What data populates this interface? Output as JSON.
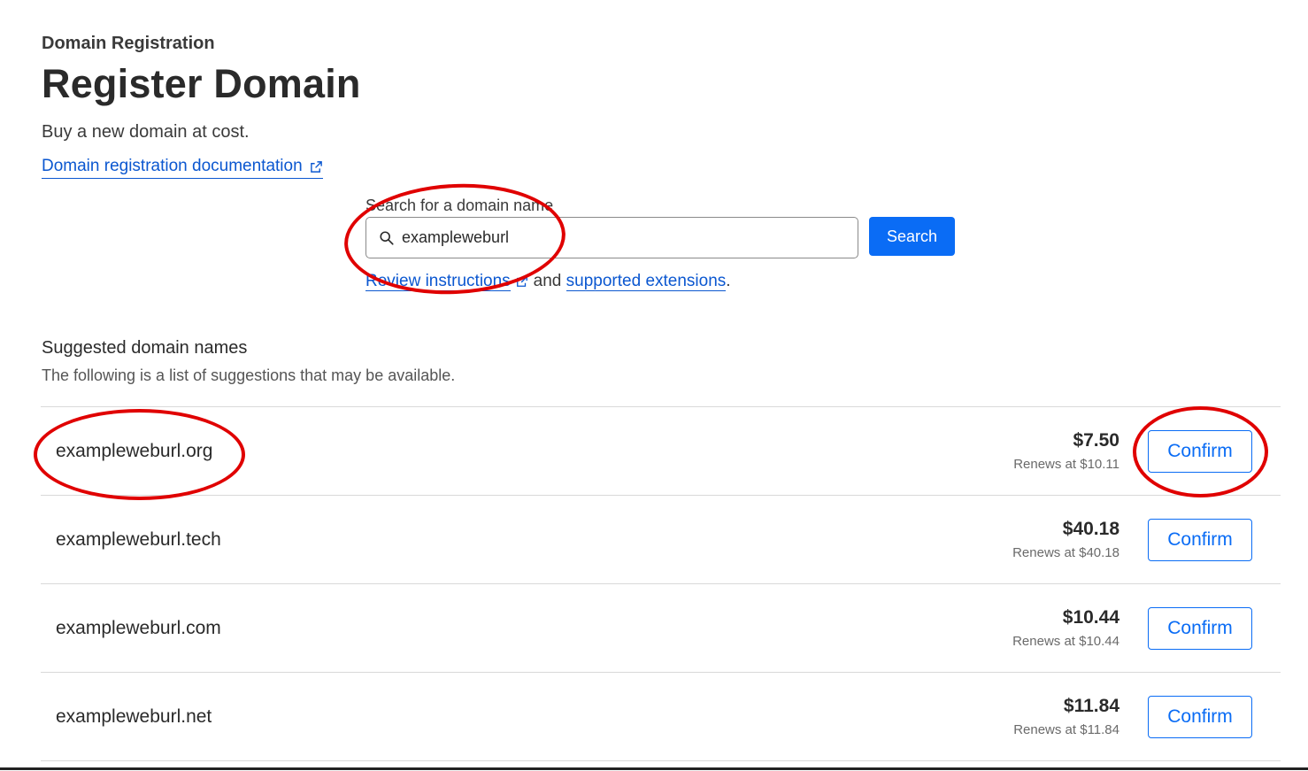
{
  "header": {
    "eyebrow": "Domain Registration",
    "title": "Register Domain",
    "subtitle": "Buy a new domain at cost.",
    "doc_link": "Domain registration documentation"
  },
  "search": {
    "label": "Search for a domain name",
    "value": "exampleweburl",
    "button_label": "Search",
    "help_link_1": "Review instructions",
    "help_and": "and",
    "help_link_2": "supported extensions",
    "help_period": "."
  },
  "suggestions": {
    "title": "Suggested domain names",
    "subtitle": "The following is a list of suggestions that may be available.",
    "items": [
      {
        "domain": "exampleweburl.org",
        "price": "$7.50",
        "renews": "Renews at $10.11",
        "button": "Confirm"
      },
      {
        "domain": "exampleweburl.tech",
        "price": "$40.18",
        "renews": "Renews at $40.18",
        "button": "Confirm"
      },
      {
        "domain": "exampleweburl.com",
        "price": "$10.44",
        "renews": "Renews at $10.44",
        "button": "Confirm"
      },
      {
        "domain": "exampleweburl.net",
        "price": "$11.84",
        "renews": "Renews at $11.84",
        "button": "Confirm"
      }
    ]
  },
  "icons": {
    "search": "search-icon",
    "external_link": "external-link-icon"
  },
  "colors": {
    "accent": "#0a6cf5",
    "link": "#0b57d0",
    "annotation": "#e00000"
  }
}
